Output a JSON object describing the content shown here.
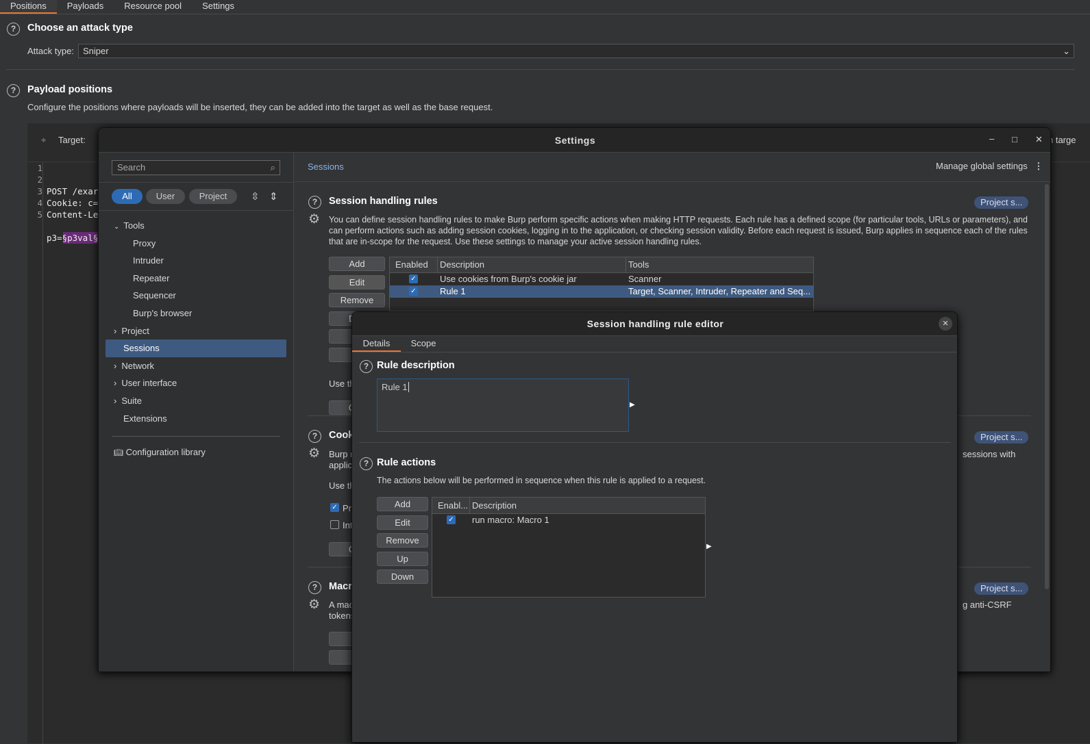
{
  "tabs": [
    "Positions",
    "Payloads",
    "Resource pool",
    "Settings"
  ],
  "attack": {
    "title": "Choose an attack type",
    "label": "Attack type:",
    "value": "Sniper"
  },
  "positions": {
    "title": "Payload positions",
    "desc": "Configure the positions where payloads will be inserted, they can be added into the target as well as the base request.",
    "target_label": "Target:",
    "right_text": "n targe",
    "lines": [
      "POST /exar",
      "Cookie: c=",
      "Content-Le",
      "",
      "p3=§p3val§"
    ],
    "line_numbers": [
      "1",
      "2",
      "3",
      "4",
      "5"
    ]
  },
  "settings": {
    "title": "Settings",
    "min": "–",
    "max": "□",
    "close": "✕",
    "search_placeholder": "Search",
    "filters": [
      "All",
      "User",
      "Project"
    ],
    "nav": [
      {
        "label": "Tools",
        "type": "group"
      },
      {
        "label": "Proxy"
      },
      {
        "label": "Intruder"
      },
      {
        "label": "Repeater"
      },
      {
        "label": "Sequencer"
      },
      {
        "label": "Burp's browser"
      },
      {
        "label": "Project",
        "type": "group"
      },
      {
        "label": "Sessions",
        "selected": true
      },
      {
        "label": "Network",
        "type": "group"
      },
      {
        "label": "User interface",
        "type": "group"
      },
      {
        "label": "Suite",
        "type": "group"
      },
      {
        "label": "Extensions"
      }
    ],
    "config_library": "Configuration library",
    "breadcrumb": "Sessions",
    "manage": "Manage global settings",
    "rules": {
      "title": "Session handling rules",
      "badge": "Project s...",
      "desc": "You can define session handling rules to make Burp perform specific actions when making HTTP requests. Each rule has a defined scope (for particular tools, URLs or parameters), and can perform actions such as adding session cookies, logging in to the application, or checking session validity. Before each request is issued, Burp applies in sequence each of the rules that are in-scope for the request. Use these settings to manage your active session handling rules.",
      "buttons": [
        "Add",
        "Edit",
        "Remove",
        "Dup",
        "",
        "D"
      ],
      "columns": [
        "Enabled",
        "Description",
        "Tools"
      ],
      "rows": [
        {
          "enabled": true,
          "description": "Use cookies from Burp's cookie jar",
          "tools": "Scanner"
        },
        {
          "enabled": true,
          "description": "Rule 1",
          "tools": "Target, Scanner, Intruder, Repeater and Seq...",
          "selected": true
        }
      ],
      "use_text": "Use th",
      "open_btn": "Ope"
    },
    "cookie": {
      "title": "Cook",
      "badge": "Project s...",
      "desc1": "Burp r",
      "desc2": "applic",
      "right": "sessions with",
      "use_text": "Use th",
      "opt1": "Pr",
      "opt2": "Int",
      "open_btn": "Ope"
    },
    "macros": {
      "title": "Macr",
      "badge": "Project s...",
      "desc1": "A mac",
      "desc2": "tokens",
      "right": "g anti-CSRF",
      "btn1": "A",
      "btn2": "E"
    }
  },
  "editor": {
    "title": "Session handling rule editor",
    "close": "✕",
    "tabs": [
      "Details",
      "Scope"
    ],
    "desc_title": "Rule description",
    "desc_value": "Rule 1",
    "actions_title": "Rule actions",
    "actions_desc": "The actions below will be performed in sequence when this rule is applied to a request.",
    "buttons": [
      "Add",
      "Edit",
      "Remove",
      "Up",
      "Down"
    ],
    "columns": [
      "Enabl...",
      "Description"
    ],
    "rows": [
      {
        "enabled": true,
        "description": "run macro: Macro 1"
      }
    ]
  },
  "colors": {
    "accent": "#e8773a",
    "selection": "#3e5a80",
    "checkbox": "#2d6bb5"
  }
}
